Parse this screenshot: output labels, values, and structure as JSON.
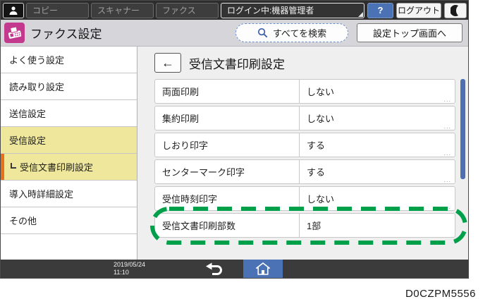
{
  "top_bar": {
    "tabs": [
      {
        "label": "コピー"
      },
      {
        "label": "スキャナー"
      },
      {
        "label": "ファクス"
      }
    ],
    "login_status": "ログイン中:機器管理者",
    "help_label": "?",
    "logout_label": "ログアウト"
  },
  "title_bar": {
    "title": "ファクス設定",
    "search_label": "すべてを検索",
    "settings_top_label": "設定トップ画面へ"
  },
  "sidebar": {
    "items": [
      {
        "label": "よく使う設定"
      },
      {
        "label": "読み取り設定"
      },
      {
        "label": "送信設定"
      },
      {
        "label": "受信設定"
      },
      {
        "label": "受信文書印刷設定"
      },
      {
        "label": "導入時詳細設定"
      },
      {
        "label": "その他"
      }
    ]
  },
  "main": {
    "back_label": "←",
    "title": "受信文書印刷設定",
    "more_indicator": "...",
    "rows": [
      {
        "label": "両面印刷",
        "value": "しない"
      },
      {
        "label": "集約印刷",
        "value": "しない"
      },
      {
        "label": "しおり印字",
        "value": "する"
      },
      {
        "label": "センターマーク印字",
        "value": "する"
      },
      {
        "label": "受信時刻印字",
        "value": "しない"
      },
      {
        "label": "受信文書印刷部数",
        "value": "1部"
      }
    ]
  },
  "bottom_bar": {
    "date": "2019/05/24",
    "time": "11:10"
  },
  "caption": "D0CZPM5556",
  "colors": {
    "accent_magenta": "#c2398e",
    "selected_yellow": "#efe89c",
    "selected_orange_bar": "#e8701a",
    "highlight_green": "#00a04b",
    "scrollbar_blue": "#4e70b0",
    "button_blue": "#4a72b4",
    "top_bar_bg": "#2d2d2d",
    "bottom_bar_bg": "#3b3b3b"
  }
}
